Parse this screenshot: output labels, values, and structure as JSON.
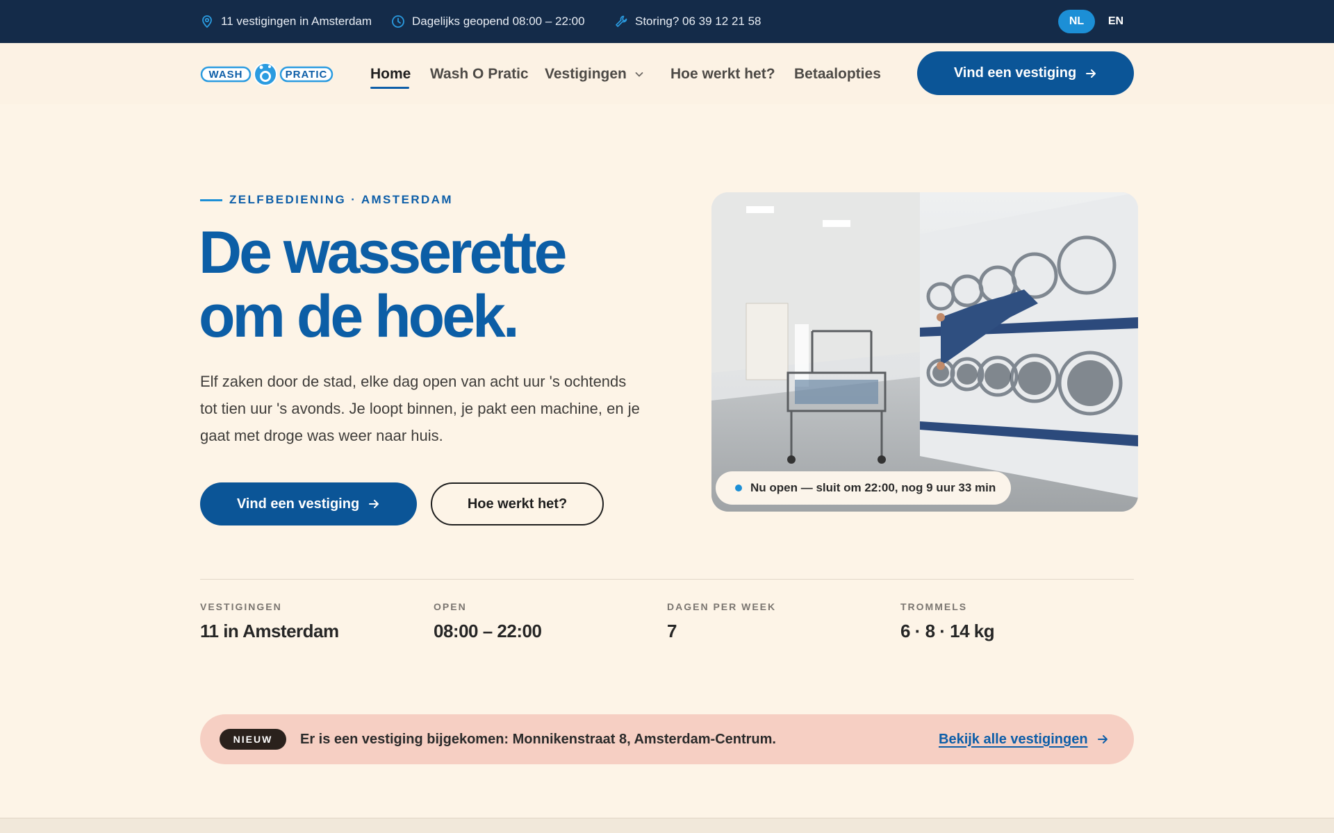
{
  "topbar": {
    "locations": "11 vestigingen in Amsterdam",
    "hours": "Dagelijks geopend 08:00 – 22:00",
    "support": "Storing? 06 39 12 21 58",
    "lang_active": "NL",
    "lang_other": "EN",
    "icons": [
      "location-pin-icon",
      "clock-icon",
      "wrench-icon"
    ]
  },
  "header": {
    "logo_text_left": "WASH",
    "logo_text_right": "PRATIC",
    "nav": [
      "Home",
      "Wash O Pratic",
      "Vestigingen",
      "Hoe werkt het?",
      "Betaalopties"
    ],
    "cta": "Vind een vestiging"
  },
  "hero": {
    "eyebrow": "ZELFBEDIENING · AMSTERDAM",
    "title_line1": "De wasserette",
    "title_line2": "om de hoek.",
    "text": "Elf zaken door de stad, elke dag open van acht uur 's ochtends tot tien uur 's avonds. Je loopt binnen, je pakt een machine, en je gaat met droge was weer naar huis.",
    "primary_button": "Vind een vestiging",
    "secondary_button": "Hoe werkt het?",
    "status": "Nu open — sluit om 22:00, nog 9 uur 33 min"
  },
  "stats": [
    {
      "label": "VESTIGINGEN",
      "value": "11 in Amsterdam"
    },
    {
      "label": "OPEN",
      "value": "08:00 – 22:00"
    },
    {
      "label": "DAGEN PER WEEK",
      "value": "7"
    },
    {
      "label": "TROMMELS",
      "value": "6 · 8 · 14 kg"
    }
  ],
  "banner": {
    "badge": "NIEUW",
    "text": "Er is een vestiging bijgekomen: Monnikenstraat 8, Amsterdam-Centrum.",
    "link": "Bekijk alle vestigingen"
  },
  "colors": {
    "primary": "#0b5597",
    "accent": "#1c8fd6",
    "topbar": "#142b49",
    "background": "#fdf4e7",
    "banner": "#f6cfc3"
  }
}
